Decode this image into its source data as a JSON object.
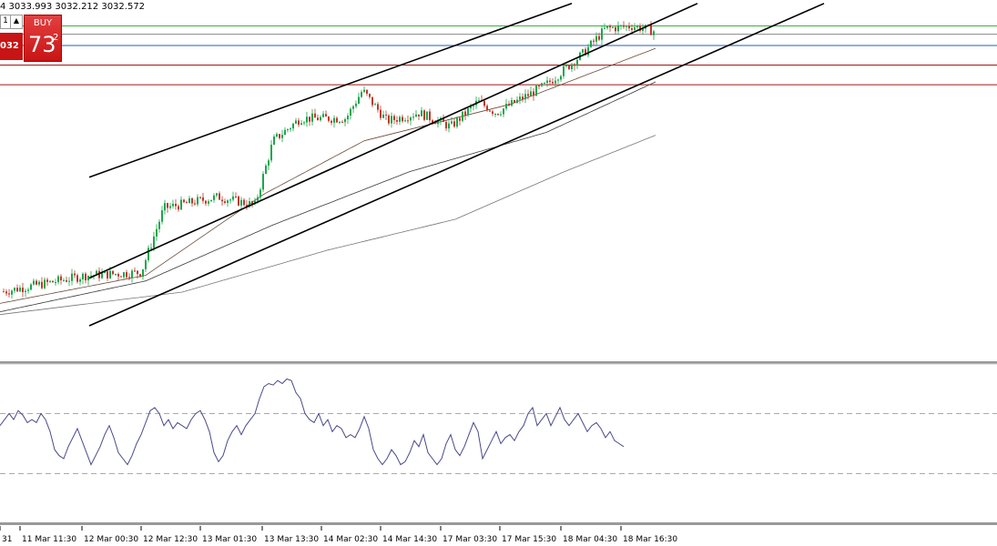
{
  "header": {
    "ohlc_text": "4 3033.993 3032.212 3032.572"
  },
  "trade_panel": {
    "buy_label": "BUY",
    "price_small": "032",
    "price_big": "73",
    "price_sup": "2",
    "arrow_glyph": "▲",
    "lot_fragment": "1"
  },
  "colors": {
    "up_candle": "#1aa64b",
    "down_candle": "#c0392b",
    "channel": "#000000",
    "level_green": "#3cb043",
    "level_blue": "#1f5fbf",
    "level_red": "#a01818",
    "level_gray": "#888888",
    "ma_fast": "#6b4a3a",
    "ma_mid": "#3a3a3a",
    "ma_slow": "#777777",
    "oscillator": "#4a4a8a"
  },
  "chart_data": {
    "type": "candlestick",
    "symbol_note": "",
    "x_ticks": [
      "31",
      "11 Mar 11:30",
      "12 Mar 00:30",
      "12 Mar 12:30",
      "13 Mar 01:30",
      "13 Mar 13:30",
      "14 Mar 02:30",
      "14 Mar 14:30",
      "17 Mar 03:30",
      "17 Mar 15:30",
      "18 Mar 04:30",
      "18 Mar 16:30"
    ],
    "price_anchors": [
      {
        "x": 0,
        "close": 0.12
      },
      {
        "x": 95,
        "close": 0.18
      },
      {
        "x": 155,
        "close": 0.19
      },
      {
        "x": 180,
        "close": 0.42
      },
      {
        "x": 240,
        "close": 0.46
      },
      {
        "x": 280,
        "close": 0.43
      },
      {
        "x": 300,
        "close": 0.66
      },
      {
        "x": 330,
        "close": 0.74
      },
      {
        "x": 380,
        "close": 0.74
      },
      {
        "x": 398,
        "close": 0.84
      },
      {
        "x": 425,
        "close": 0.73
      },
      {
        "x": 460,
        "close": 0.76
      },
      {
        "x": 495,
        "close": 0.71
      },
      {
        "x": 525,
        "close": 0.8
      },
      {
        "x": 545,
        "close": 0.76
      },
      {
        "x": 600,
        "close": 0.86
      },
      {
        "x": 640,
        "close": 0.97
      },
      {
        "x": 665,
        "close": 1.06
      },
      {
        "x": 695,
        "close": 1.07
      },
      {
        "x": 720,
        "close": 1.05
      }
    ],
    "moving_averages": [
      {
        "name": "",
        "anchors": [
          {
            "x": 0,
            "v": 0.08
          },
          {
            "x": 160,
            "v": 0.18
          },
          {
            "x": 290,
            "v": 0.47
          },
          {
            "x": 400,
            "v": 0.66
          },
          {
            "x": 560,
            "v": 0.79
          },
          {
            "x": 720,
            "v": 0.99
          }
        ]
      },
      {
        "name": "",
        "anchors": [
          {
            "x": 0,
            "v": 0.05
          },
          {
            "x": 160,
            "v": 0.16
          },
          {
            "x": 300,
            "v": 0.36
          },
          {
            "x": 450,
            "v": 0.55
          },
          {
            "x": 600,
            "v": 0.69
          },
          {
            "x": 720,
            "v": 0.87
          }
        ]
      },
      {
        "name": "",
        "anchors": [
          {
            "x": 0,
            "v": 0.04
          },
          {
            "x": 200,
            "v": 0.12
          },
          {
            "x": 360,
            "v": 0.27
          },
          {
            "x": 500,
            "v": 0.38
          },
          {
            "x": 620,
            "v": 0.55
          },
          {
            "x": 720,
            "v": 0.68
          }
        ]
      }
    ],
    "channel_lines": [
      {
        "from": [
          98,
          0.53
        ],
        "to": [
          628,
          1.15
        ]
      },
      {
        "from": [
          98,
          0.17
        ],
        "to": [
          766,
          1.15
        ]
      },
      {
        "from": [
          98,
          0.0
        ],
        "to": [
          905,
          1.15
        ]
      }
    ],
    "horizontal_levels": [
      {
        "value": 1.07,
        "color": "level_green"
      },
      {
        "value": 1.04,
        "color": "level_gray"
      },
      {
        "value": 1.0,
        "color": "level_blue"
      },
      {
        "value": 0.93,
        "color": "level_red"
      },
      {
        "value": 0.86,
        "color": "level_red"
      }
    ],
    "oscillator": {
      "upper_level": 0.7,
      "lower_level": 0.3,
      "values_x_step": 5,
      "values": [
        0.62,
        0.66,
        0.7,
        0.66,
        0.72,
        0.69,
        0.64,
        0.66,
        0.64,
        0.7,
        0.66,
        0.58,
        0.46,
        0.42,
        0.4,
        0.48,
        0.54,
        0.6,
        0.52,
        0.44,
        0.36,
        0.42,
        0.48,
        0.56,
        0.62,
        0.54,
        0.44,
        0.4,
        0.36,
        0.42,
        0.5,
        0.56,
        0.64,
        0.72,
        0.74,
        0.7,
        0.62,
        0.66,
        0.6,
        0.64,
        0.62,
        0.6,
        0.66,
        0.7,
        0.72,
        0.66,
        0.58,
        0.44,
        0.38,
        0.42,
        0.52,
        0.58,
        0.62,
        0.56,
        0.62,
        0.66,
        0.7,
        0.8,
        0.88,
        0.9,
        0.89,
        0.92,
        0.9,
        0.93,
        0.92,
        0.84,
        0.8,
        0.7,
        0.66,
        0.64,
        0.7,
        0.62,
        0.66,
        0.58,
        0.62,
        0.6,
        0.54,
        0.56,
        0.54,
        0.6,
        0.68,
        0.6,
        0.46,
        0.4,
        0.36,
        0.4,
        0.46,
        0.42,
        0.36,
        0.38,
        0.44,
        0.52,
        0.48,
        0.56,
        0.44,
        0.4,
        0.36,
        0.4,
        0.5,
        0.56,
        0.46,
        0.42,
        0.48,
        0.56,
        0.64,
        0.58,
        0.4,
        0.46,
        0.52,
        0.58,
        0.5,
        0.54,
        0.56,
        0.52,
        0.58,
        0.62,
        0.7,
        0.74,
        0.62,
        0.66,
        0.7,
        0.62,
        0.68,
        0.74,
        0.66,
        0.62,
        0.66,
        0.7,
        0.64,
        0.58,
        0.62,
        0.64,
        0.6,
        0.54,
        0.58,
        0.52,
        0.5,
        0.48
      ]
    },
    "grid": false
  }
}
